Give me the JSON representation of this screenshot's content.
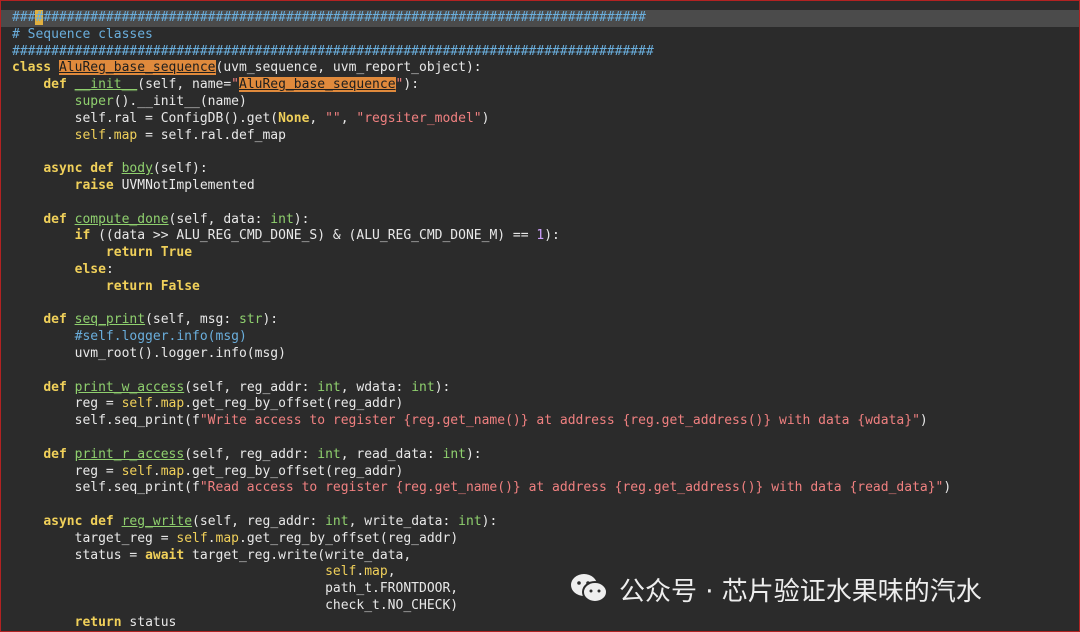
{
  "code_lines": [
    "###▌#############################################################################",
    "# Sequence classes",
    "##################################################################################",
    "class AluReg_base_sequence(uvm_sequence, uvm_report_object):",
    "    def __init__(self, name=\"AluReg_base_sequence\"):",
    "        super().__init__(name)",
    "        self.ral = ConfigDB().get(None, \"\", \"regsiter_model\")",
    "        self.map = self.ral.def_map",
    "",
    "    async def body(self):",
    "        raise UVMNotImplemented",
    "",
    "    def compute_done(self, data: int):",
    "        if ((data >> ALU_REG_CMD_DONE_S) & (ALU_REG_CMD_DONE_M) == 1):",
    "            return True",
    "        else:",
    "            return False",
    "",
    "    def seq_print(self, msg: str):",
    "        #self.logger.info(msg)",
    "        uvm_root().logger.info(msg)",
    "",
    "    def print_w_access(self, reg_addr: int, wdata: int):",
    "        reg = self.map.get_reg_by_offset(reg_addr)",
    "        self.seq_print(f\"Write access to register {reg.get_name()} at address {reg.get_address()} with data {wdata}\")",
    "",
    "    def print_r_access(self, reg_addr: int, read_data: int):",
    "        reg = self.map.get_reg_by_offset(reg_addr)",
    "        self.seq_print(f\"Read access to register {reg.get_name()} at address {reg.get_address()} with data {read_data}\")",
    "",
    "    async def reg_write(self, reg_addr: int, write_data: int):",
    "        target_reg = self.map.get_reg_by_offset(reg_addr)",
    "        status = await target_reg.write(write_data,",
    "                                        self.map,",
    "                                        path_t.FRONTDOOR,",
    "                                        check_t.NO_CHECK)",
    "        return status"
  ],
  "watermark": {
    "text": "公众号 · 芯片验证水果味的汽水",
    "icon": "wechat-icon"
  },
  "colors": {
    "keyword": "#f0d05a",
    "function": "#8fd06e",
    "string": "#f08080",
    "number": "#cfa0ff",
    "comment": "#6aaedc",
    "highlight": "#e08a3c",
    "background": "#2b2b2b"
  }
}
